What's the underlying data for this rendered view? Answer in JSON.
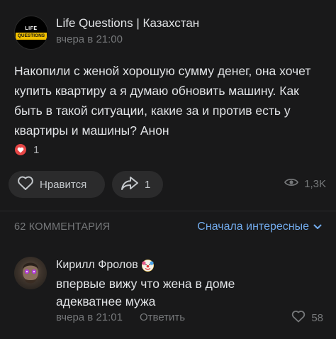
{
  "post": {
    "avatar_line1": "LIFE",
    "avatar_line2": "QUESTIONS",
    "group_name": "Life Questions | Казахстан",
    "time": "вчера в 21:00",
    "text": "Накопили с женой хорошую сумму денег, она хочет купить квартиру а я думаю обновить машину. Как быть в такой ситуации, какие за и против есть у квартиры и машины? Анон",
    "reaction_count": "1",
    "like_label": "Нравится",
    "share_count": "1",
    "views": "1,3K"
  },
  "comments_header": {
    "count_label": "62 КОММЕНТАРИЯ",
    "sort_label": "Сначала интересные"
  },
  "comment": {
    "author": "Кирилл Фролов",
    "text": "впервые вижу что жена в доме адекватнее мужа",
    "time": "вчера в 21:01",
    "reply_label": "Ответить",
    "likes": "58"
  },
  "icons": {
    "heart": "heart-icon",
    "share": "share-icon",
    "eye": "eye-icon",
    "chevron": "chevron-down-icon",
    "clown": "clown-emoji-icon"
  },
  "colors": {
    "background": "#19191a",
    "accent": "#71aaeb",
    "reaction_red": "#e64646",
    "muted": "#76787a"
  }
}
